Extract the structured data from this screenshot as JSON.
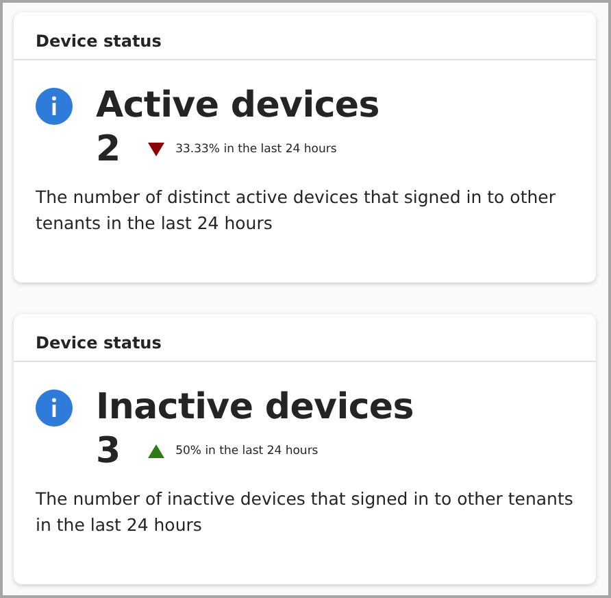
{
  "cards": [
    {
      "header": "Device status",
      "title": "Active devices",
      "count": "2",
      "rising": false,
      "change": "33.33% in the last 24 hours",
      "description": "The number of distinct active devices that signed in to other tenants in the last 24 hours"
    },
    {
      "header": "Device status",
      "title": "Inactive devices",
      "count": "3",
      "rising": true,
      "change": "50% in the last 24 hours",
      "description": "The number of inactive devices that signed in to other tenants in the last 24 hours"
    }
  ]
}
